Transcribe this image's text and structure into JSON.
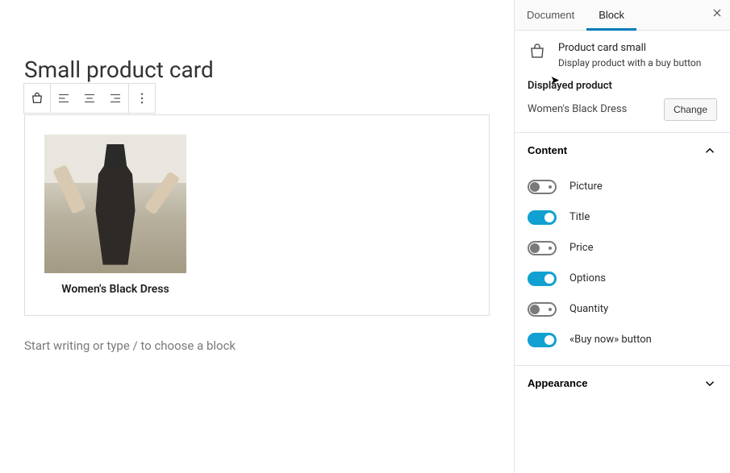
{
  "editor": {
    "pageTitle": "Small product card",
    "placeholder": "Start writing or type / to choose a block",
    "toolbar": {
      "icons": [
        "block-icon",
        "align-left",
        "align-center",
        "align-right",
        "more"
      ]
    },
    "product": {
      "title": "Women's Black Dress"
    }
  },
  "sidebar": {
    "tabs": {
      "document": "Document",
      "block": "Block",
      "active": "block"
    },
    "blockMeta": {
      "title": "Product card small",
      "description": "Display product with a buy button"
    },
    "displayedProduct": {
      "label": "Displayed product",
      "value": "Women's Black Dress",
      "changeLabel": "Change"
    },
    "contentSection": {
      "title": "Content",
      "open": true,
      "toggles": [
        {
          "name": "picture",
          "label": "Picture",
          "on": false
        },
        {
          "name": "title",
          "label": "Title",
          "on": true
        },
        {
          "name": "price",
          "label": "Price",
          "on": false
        },
        {
          "name": "options",
          "label": "Options",
          "on": true
        },
        {
          "name": "quantity",
          "label": "Quantity",
          "on": false
        },
        {
          "name": "buy-now",
          "label": "«Buy now» button",
          "on": true
        }
      ]
    },
    "appearanceSection": {
      "title": "Appearance",
      "open": false
    }
  }
}
